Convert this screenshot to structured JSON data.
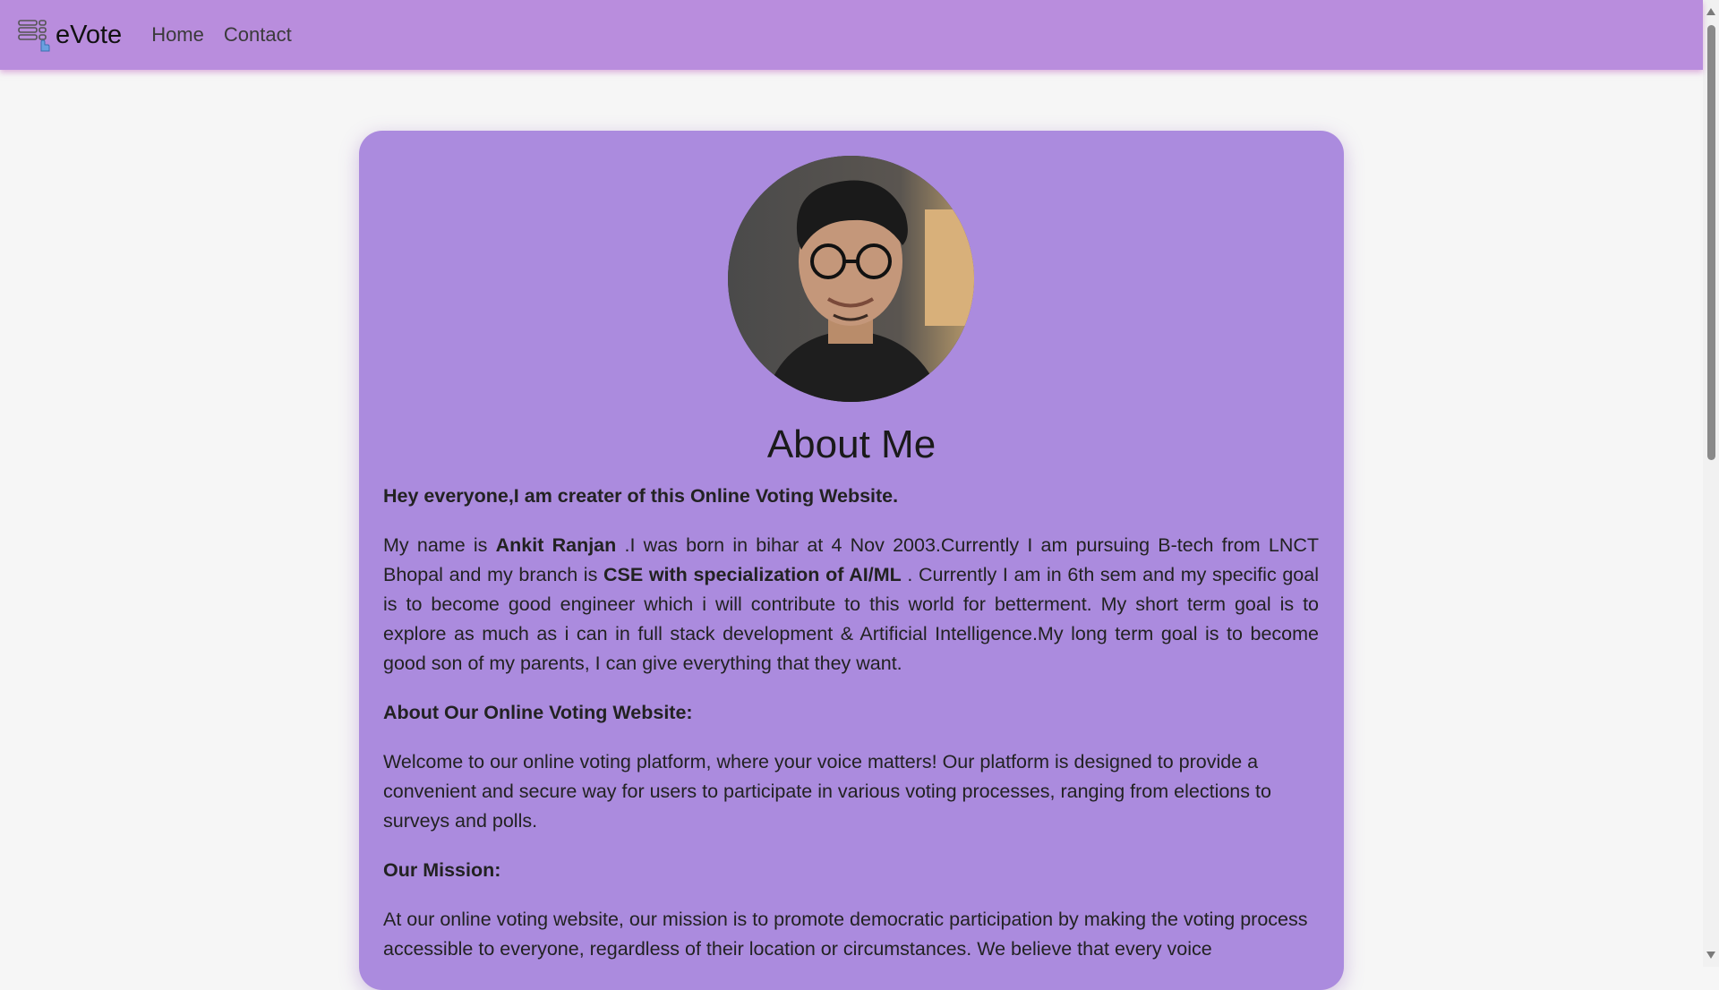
{
  "navbar": {
    "brand": "eVote",
    "links": [
      "Home",
      "Contact"
    ],
    "bg_color": "#b98ddd"
  },
  "profile": {
    "photo_alt": "profile photo"
  },
  "about": {
    "title": "About Me",
    "intro": "Hey everyone,I am creater of this Online Voting Website.",
    "bio": {
      "part1": "My name is ",
      "name": "Ankit Ranjan",
      "part2": " .I was born in bihar at 4 Nov 2003.Currently I am pursuing B-tech from LNCT Bhopal and my branch is ",
      "branch": "CSE with specialization of AI/ML",
      "part3": " . Currently I am in 6th sem and my specific goal is to become good engineer which i will contribute to this world for betterment. My short term goal is to explore as much as i can in full stack development & Artificial Intelligence.My long term goal is to become good son of my parents, I can give everything that they want."
    },
    "website_heading": "About Our Online Voting Website:",
    "website_text": "Welcome to our online voting platform, where your voice matters! Our platform is designed to provide a convenient and secure way for users to participate in various voting processes, ranging from elections to surveys and polls.",
    "mission_heading": "Our Mission:",
    "mission_text": "At our online voting website, our mission is to promote democratic participation by making the voting process accessible to everyone, regardless of their location or circumstances. We believe that every voice"
  },
  "colors": {
    "card": "#ab8bde",
    "page_bg": "#f6f6f6"
  }
}
